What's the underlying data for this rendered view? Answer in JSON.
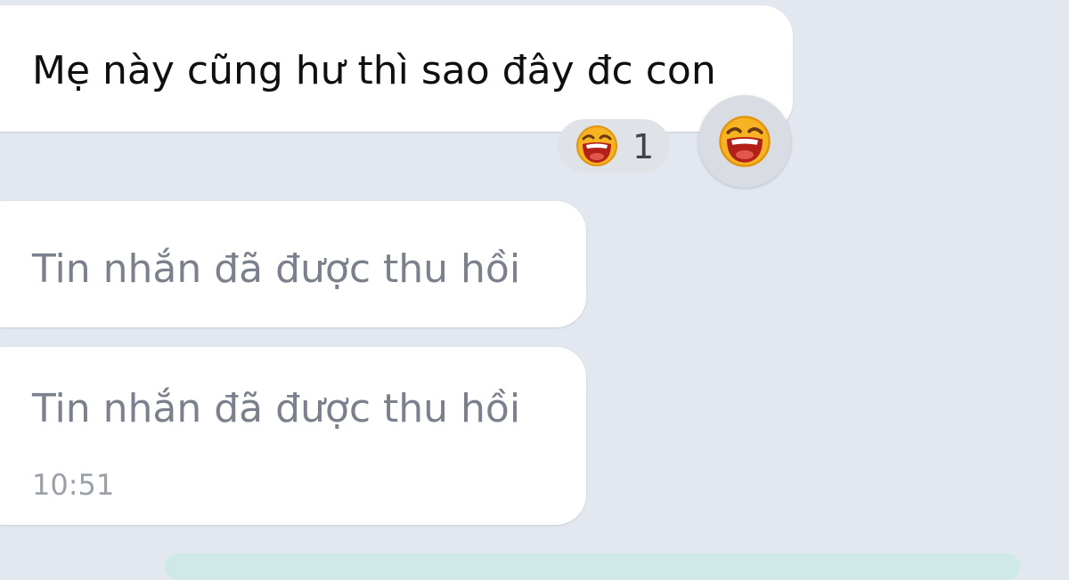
{
  "messages": [
    {
      "text": "Mẹ này cũng hư thì sao đây đc con",
      "recalled": false
    },
    {
      "text": "Tin nhắn đã được thu hồi",
      "recalled": true
    },
    {
      "text": "Tin nhắn đã được thu hồi",
      "recalled": true,
      "time": "10:51"
    }
  ],
  "reaction": {
    "icon": "laughing-face-icon",
    "count": "1"
  },
  "react_button": {
    "icon": "laughing-face-icon"
  },
  "colors": {
    "background": "#e3e8f0",
    "bubble": "#ffffff",
    "recalled_text": "#7b818c",
    "emoji_face": "#f8b322",
    "emoji_mouth": "#b32018"
  }
}
